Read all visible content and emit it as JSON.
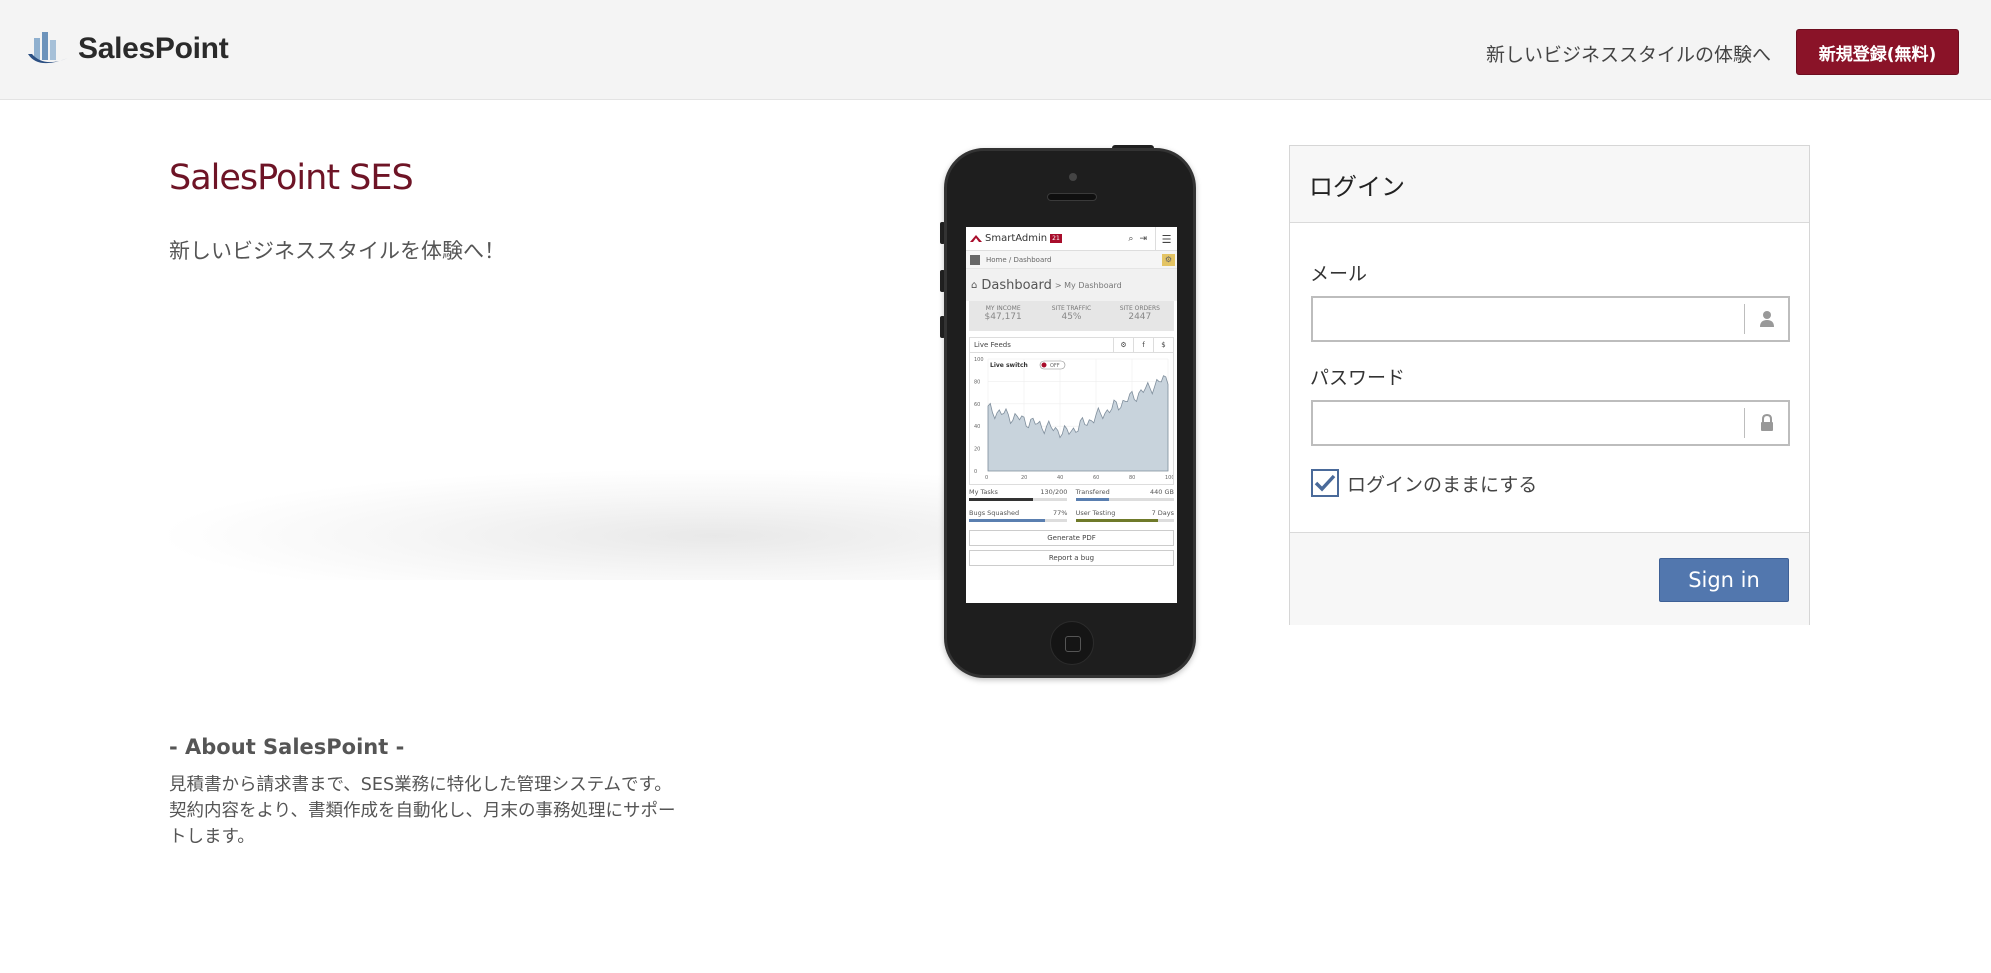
{
  "header": {
    "brand": "SalesPoint",
    "tagline": "新しいビジネススタイルの体験へ",
    "register_label": "新規登録(無料)"
  },
  "hero": {
    "title": "SalesPoint SES",
    "subtitle": "新しいビジネススタイルを体験へ！"
  },
  "about": {
    "title": "- About SalesPoint -",
    "text": "見積書から請求書まで、SES業務に特化した管理システムです。契約内容をより、書類作成を自動化し、月末の事務処理にサポートします。"
  },
  "phone_screen": {
    "app_name": "SmartAdmin",
    "app_badge": "21",
    "breadcrumb": "Home / Dashboard",
    "dashboard_title": "Dashboard",
    "dashboard_sub": "> My Dashboard",
    "stats": [
      {
        "label": "MY INCOME",
        "value": "$47,171"
      },
      {
        "label": "SITE TRAFFIC",
        "value": "45%"
      },
      {
        "label": "SITE ORDERS",
        "value": "2447"
      }
    ],
    "feeds_tab": "Live Feeds",
    "live_switch": "Live switch",
    "switch_state": "OFF",
    "y_ticks": [
      "100",
      "80",
      "60",
      "40",
      "20",
      "0"
    ],
    "x_ticks": [
      "0",
      "20",
      "40",
      "60",
      "80",
      "100"
    ],
    "progress": [
      {
        "label": "My Tasks",
        "value": "130/200",
        "fill": 0.65,
        "color": "#333333"
      },
      {
        "label": "Transfered",
        "value": "440 GB",
        "fill": 0.34,
        "color": "#5a7fb0"
      },
      {
        "label": "Bugs Squashed",
        "value": "77%",
        "fill": 0.77,
        "color": "#5a7fb0"
      },
      {
        "label": "User Testing",
        "value": "7 Days",
        "fill": 0.84,
        "color": "#6f7a2a"
      }
    ],
    "button_pdf": "Generate PDF",
    "button_bug": "Report a bug"
  },
  "login": {
    "title": "ログイン",
    "email_label": "メール",
    "email_value": "",
    "password_label": "パスワード",
    "password_value": "",
    "remember_label": "ログインのままにする",
    "remember_checked": true,
    "signin_label": "Sign in"
  },
  "colors": {
    "brand_red": "#8a1328",
    "signin_blue": "#5277ae",
    "title_red": "#6e1426"
  }
}
